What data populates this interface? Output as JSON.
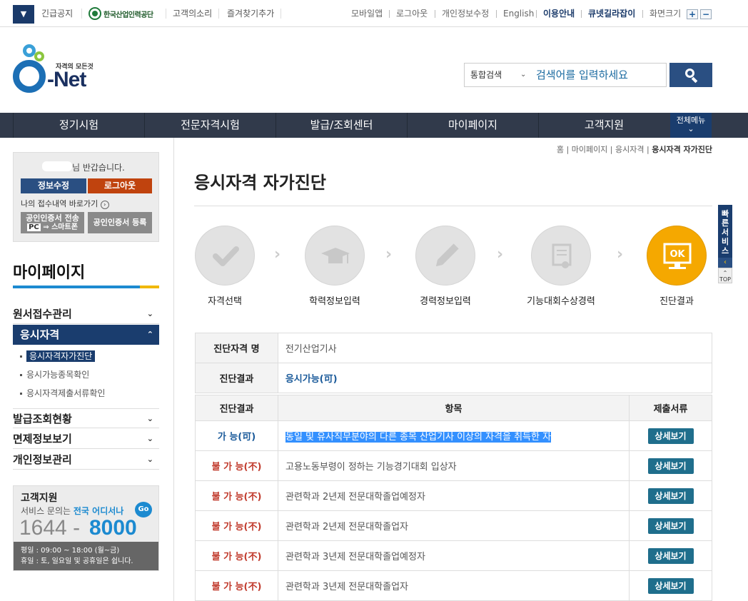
{
  "topbar": {
    "emergency": "긴급공지",
    "org_name": "한국산업인력공단",
    "voice": "고객의소리",
    "favorites": "즐겨찾기추가",
    "mobile": "모바일앱",
    "logout": "로그아웃",
    "edit_profile": "개인정보수정",
    "english": "English",
    "guide": "이용안내",
    "qnet_guide": "큐넷길라잡이",
    "screen_size": "화면크기",
    "zoom_in": "+",
    "zoom_out": "−"
  },
  "logo": {
    "tagline": "자격의 모든것",
    "name": "Net"
  },
  "search": {
    "scope": "통합검색",
    "placeholder": "검색어를 입력하세요"
  },
  "gnb": [
    "정기시험",
    "전문자격시험",
    "발급/조회센터",
    "마이페이지",
    "고객지원"
  ],
  "gnb_all": "전체메뉴",
  "user": {
    "greeting": "님 반갑습니다.",
    "edit_btn": "정보수정",
    "logout_btn": "로그아웃",
    "receipt_link": "나의 접수내역 바로가기",
    "cert_transfer": "공인인증서 전송",
    "cert_transfer_sub": "스마트폰",
    "cert_pc": "PC",
    "cert_register": "공인인증서 등록"
  },
  "sidebar": {
    "title": "마이페이지",
    "menus": [
      {
        "label": "원서접수관리",
        "arrow": "⌄"
      },
      {
        "label": "응시자격",
        "arrow": "⌃"
      },
      {
        "label": "발급조회현황",
        "arrow": "⌄"
      },
      {
        "label": "면제정보보기",
        "arrow": "⌄"
      },
      {
        "label": "개인정보관리",
        "arrow": "⌄"
      }
    ],
    "submenus": [
      "응시자격자가진단",
      "응시가능종목확인",
      "응시자격제출서류확인"
    ]
  },
  "support": {
    "title": "고객지원",
    "desc": "서비스 문의는",
    "desc_highlight": "전국 어디서나",
    "go": "Go",
    "phone_a": "1644 -",
    "phone_b": "8000",
    "hours_weekday": "평일 : 09:00 ~ 18:00 (월~금)",
    "hours_holiday": "휴일 : 토, 일요일 및 공휴일은 쉽니다."
  },
  "breadcrumb": {
    "home": "홈",
    "mypage": "마이페이지",
    "qual": "응시자격",
    "current": "응시자격 자가진단"
  },
  "page_title": "응시자격 자가진단",
  "steps": [
    "자격선택",
    "학력정보입력",
    "경력정보입력",
    "기능대회수상경력",
    "진단결과"
  ],
  "step_ok": "OK",
  "info": {
    "name_label": "진단자격 명",
    "name_value": "전기산업기사",
    "result_label": "진단결과",
    "result_value": "응시가능(可)"
  },
  "results": {
    "headers": [
      "진단결과",
      "항목",
      "제출서류"
    ],
    "detail_btn": "상세보기",
    "rows": [
      {
        "status": "가 능(可)",
        "ok": true,
        "item": "동일 및 유사직무분야의 다른 종목 산업기사 이상의 자격을 취득한 자"
      },
      {
        "status": "불 가 능(不)",
        "ok": false,
        "item": "고용노동부령이 정하는 기능경기대회 입상자"
      },
      {
        "status": "불 가 능(不)",
        "ok": false,
        "item": "관련학과 2년제 전문대학졸업예정자"
      },
      {
        "status": "불 가 능(不)",
        "ok": false,
        "item": "관련학과 2년제 전문대학졸업자"
      },
      {
        "status": "불 가 능(不)",
        "ok": false,
        "item": "관련학과 3년제 전문대학졸업예정자"
      },
      {
        "status": "불 가 능(不)",
        "ok": false,
        "item": "관련학과 3년제 전문대학졸업자"
      }
    ]
  },
  "quick": {
    "label": "빠른서비스",
    "top": "TOP"
  },
  "colors": {
    "navy": "#1a3d6e",
    "gnb": "#313a4b",
    "accent": "#1c8ad0",
    "ok": "#1a5a9a",
    "no": "#c0392b",
    "active_step": "#f5a800"
  }
}
